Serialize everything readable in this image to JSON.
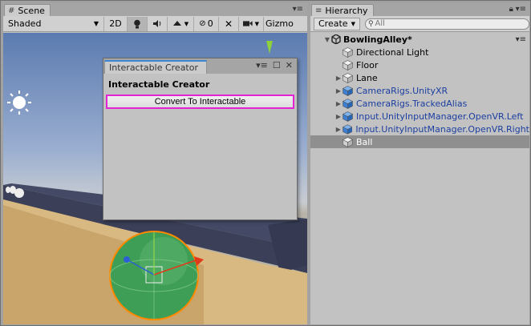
{
  "scene": {
    "tab_label": "Scene",
    "shading_mode": "Shaded",
    "mode_2d": "2D",
    "hidden_count": "0",
    "gizmos_label": "Gizmo"
  },
  "float_window": {
    "tab_label": "Interactable Creator",
    "title": "Interactable Creator",
    "convert_button": "Convert To Interactable"
  },
  "hierarchy": {
    "tab_label": "Hierarchy",
    "create_label": "Create",
    "search_placeholder": "All",
    "root": {
      "label": "BowlingAlley*",
      "expanded": true
    },
    "items": [
      {
        "label": "Directional Light",
        "expandable": false,
        "prefab": false,
        "selected": false
      },
      {
        "label": "Floor",
        "expandable": false,
        "prefab": false,
        "selected": false
      },
      {
        "label": "Lane",
        "expandable": true,
        "prefab": false,
        "selected": false
      },
      {
        "label": "CameraRigs.UnityXR",
        "expandable": true,
        "prefab": true,
        "selected": false
      },
      {
        "label": "CameraRigs.TrackedAlias",
        "expandable": true,
        "prefab": true,
        "selected": false
      },
      {
        "label": "Input.UnityInputManager.OpenVR.Left",
        "expandable": true,
        "prefab": true,
        "selected": false
      },
      {
        "label": "Input.UnityInputManager.OpenVR.Right",
        "expandable": true,
        "prefab": true,
        "selected": false
      },
      {
        "label": "Ball",
        "expandable": false,
        "prefab": false,
        "selected": true
      }
    ]
  },
  "colors": {
    "selection_highlight": "#e324d4",
    "prefab_text": "#1c3fa1",
    "tab_accent": "#3d86d6"
  }
}
